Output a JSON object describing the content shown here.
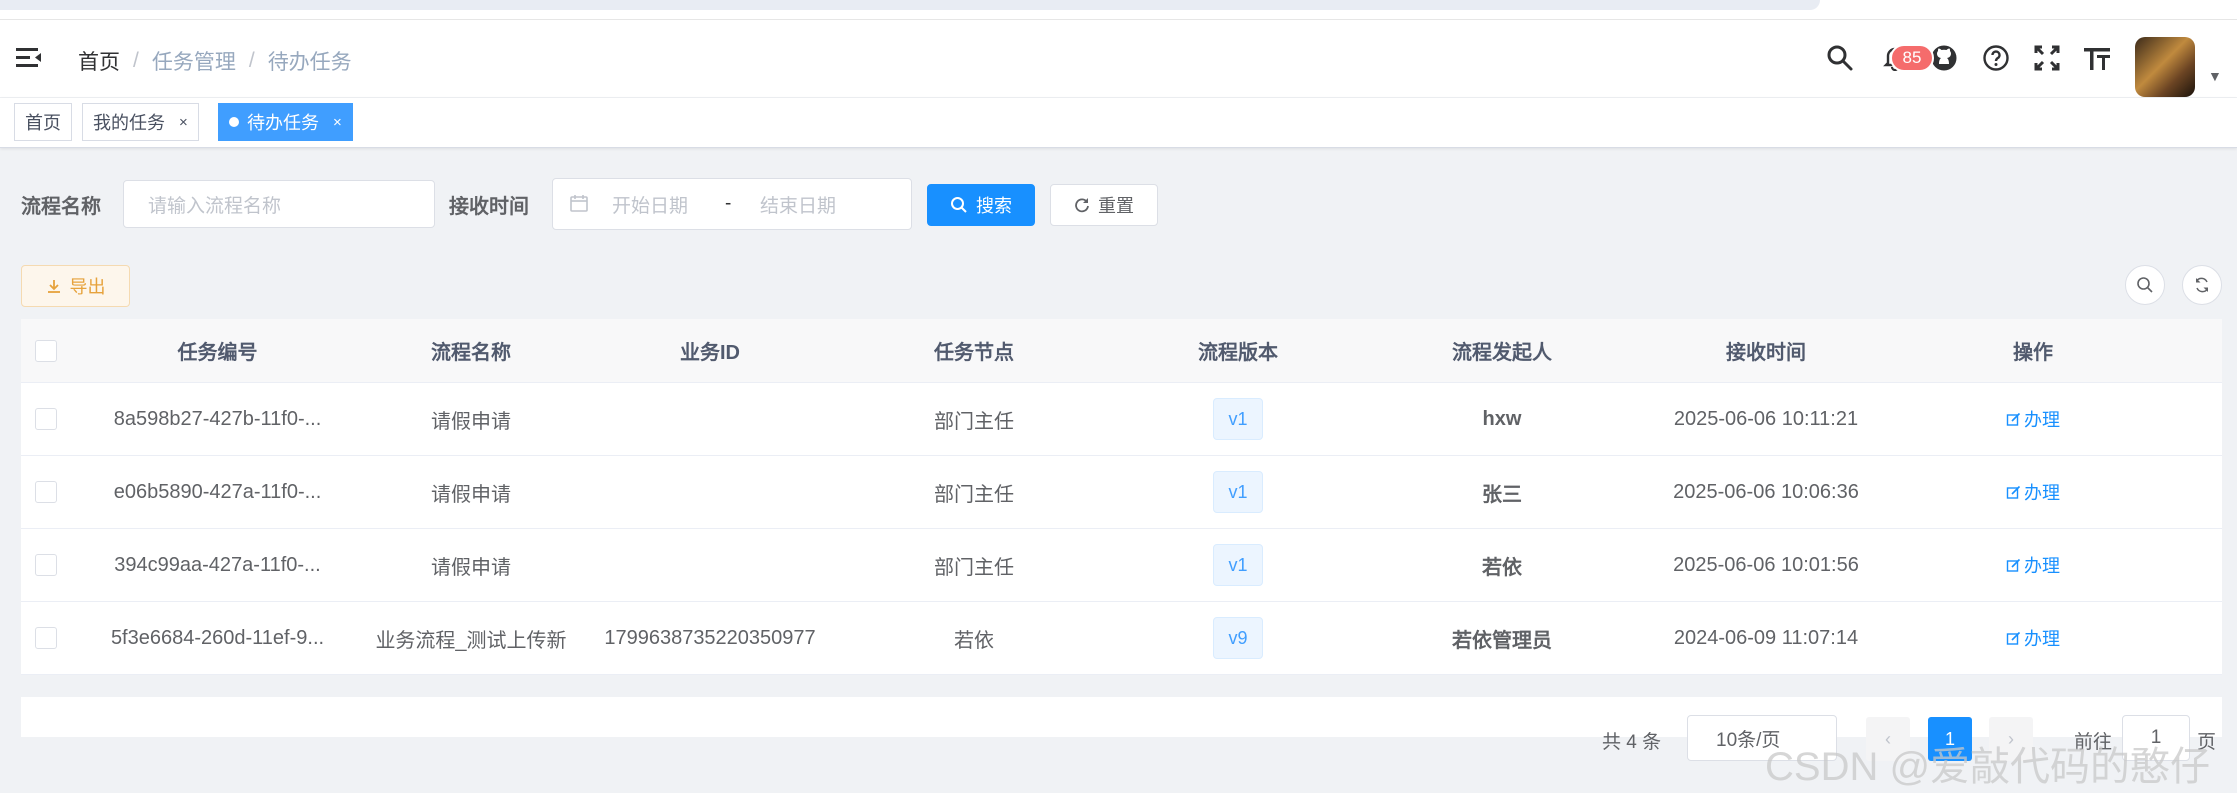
{
  "navbar": {
    "breadcrumb": [
      "首页",
      "任务管理",
      "待办任务"
    ],
    "notification_count": "85"
  },
  "tags": [
    {
      "label": "首页"
    },
    {
      "label": "我的任务"
    },
    {
      "label": "待办任务"
    }
  ],
  "search": {
    "process_name_label": "流程名称",
    "process_name_placeholder": "请输入流程名称",
    "receive_time_label": "接收时间",
    "start_date_placeholder": "开始日期",
    "range_separator": "-",
    "end_date_placeholder": "结束日期",
    "search_button": "搜索",
    "reset_button": "重置"
  },
  "toolbar": {
    "export_button": "导出"
  },
  "table": {
    "columns": [
      "任务编号",
      "流程名称",
      "业务ID",
      "任务节点",
      "流程版本",
      "流程发起人",
      "接收时间",
      "操作"
    ],
    "rows": [
      {
        "task_id": "8a598b27-427b-11f0-...",
        "process_name": "请假申请",
        "business_id": "",
        "node": "部门主任",
        "version": "v1",
        "starter": "hxw",
        "time": "2025-06-06 10:11:21",
        "action": "办理"
      },
      {
        "task_id": "e06b5890-427a-11f0-...",
        "process_name": "请假申请",
        "business_id": "",
        "node": "部门主任",
        "version": "v1",
        "starter": "张三",
        "time": "2025-06-06 10:06:36",
        "action": "办理"
      },
      {
        "task_id": "394c99aa-427a-11f0-...",
        "process_name": "请假申请",
        "business_id": "",
        "node": "部门主任",
        "version": "v1",
        "starter": "若依",
        "time": "2025-06-06 10:01:56",
        "action": "办理"
      },
      {
        "task_id": "5f3e6684-260d-11ef-9...",
        "process_name": "业务流程_测试上传新",
        "business_id": "1799638735220350977",
        "node": "若依",
        "version": "v9",
        "starter": "若依管理员",
        "time": "2024-06-09 11:07:14",
        "action": "办理"
      }
    ]
  },
  "pagination": {
    "total": "共 4 条",
    "page_size": "10条/页",
    "prev": "‹",
    "current_page": "1",
    "next": "›",
    "goto_label": "前往",
    "goto_value": "1",
    "page_suffix": "页"
  },
  "watermark": "CSDN @爱敲代码的憨仔",
  "colors": {
    "primary": "#1890ff",
    "warning": "#e6a23c",
    "danger": "#f56c6c"
  }
}
